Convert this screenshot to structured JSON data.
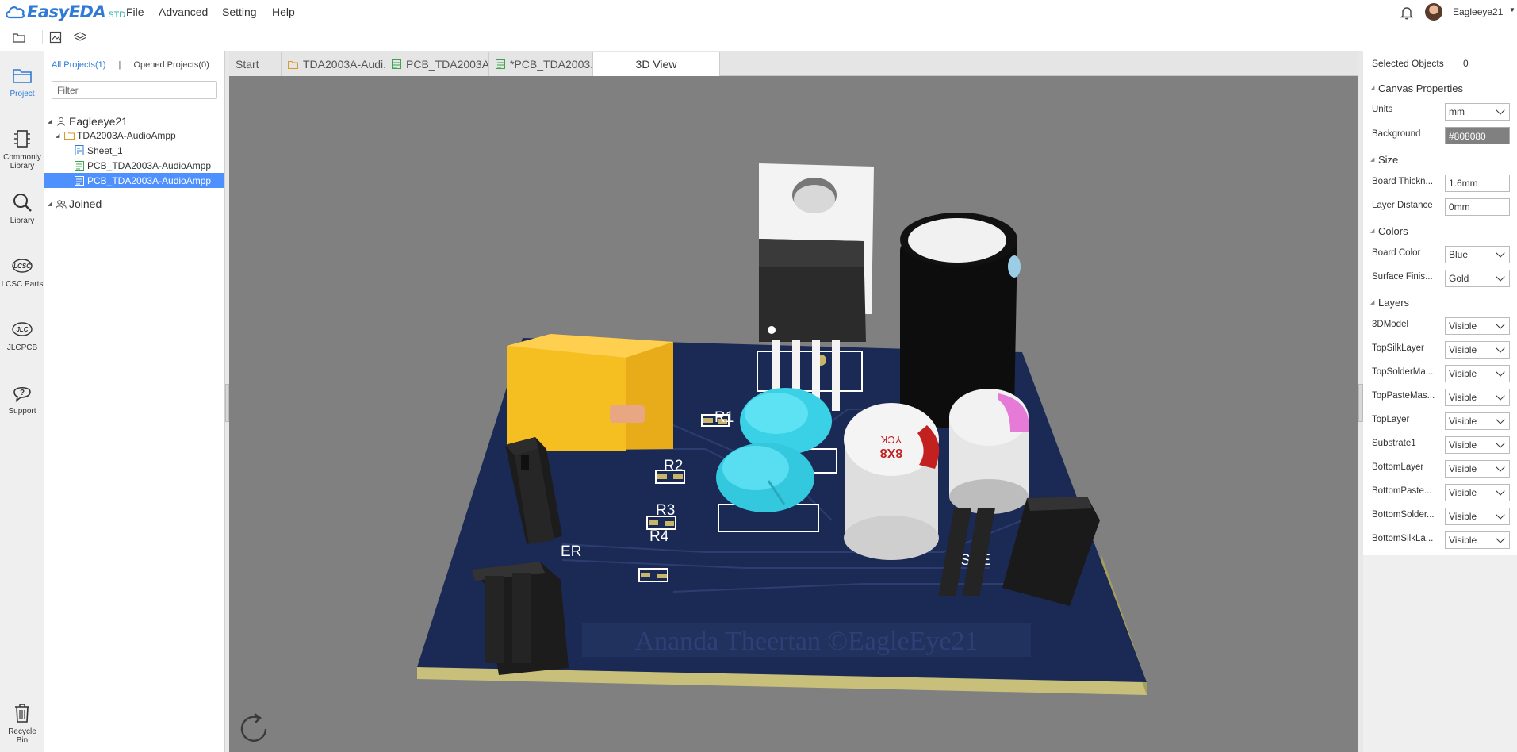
{
  "app": {
    "brand": "EasyEDA",
    "edition": "STD",
    "menu": [
      "File",
      "Advanced",
      "Setting",
      "Help"
    ],
    "username": "Eagleeye21"
  },
  "rail": {
    "items": [
      {
        "label1": "Project",
        "label2": "",
        "icon": "project-icon"
      },
      {
        "label1": "Commonly",
        "label2": "Library",
        "icon": "commonly-library-icon"
      },
      {
        "label1": "Library",
        "label2": "",
        "icon": "library-search-icon"
      },
      {
        "label1": "LCSC Parts",
        "label2": "",
        "icon": "lcsc-icon"
      },
      {
        "label1": "JLCPCB",
        "label2": "",
        "icon": "jlcpcb-icon"
      },
      {
        "label1": "Support",
        "label2": "",
        "icon": "support-icon"
      },
      {
        "label1": "Recycle",
        "label2": "Bin",
        "icon": "trash-icon"
      }
    ]
  },
  "project_panel": {
    "tab_all": "All Projects(1)",
    "tab_separator": "|",
    "tab_opened": "Opened Projects(0)",
    "filter_placeholder": "Filter",
    "tree": {
      "owner": "Eagleeye21",
      "project": "TDA2003A-AudioAmpp",
      "sheet": "Sheet_1",
      "pcb1": "PCB_TDA2003A-AudioAmpp",
      "pcb2": "PCB_TDA2003A-AudioAmpp",
      "joined": "Joined"
    }
  },
  "doc_tabs": {
    "start": "Start",
    "schematic": "TDA2003A-Audi...",
    "pcb": "PCB_TDA2003A...",
    "pcb_modified": "*PCB_TDA2003...",
    "view3d": "3D View"
  },
  "scene": {
    "silk_r1": "R1",
    "silk_r2": "R2",
    "silk_r3": "R3",
    "silk_r4": "R4",
    "silk_er": "ER",
    "silk_spe": "SPE",
    "watermark": "Ananda Theertan ©EagleEye21",
    "cap_marking_1": "8X8",
    "cap_marking_2": "YCK"
  },
  "properties": {
    "selected_label": "Selected Objects",
    "selected_count": "0",
    "canvas_header": "Canvas Properties",
    "units_label": "Units",
    "units_value": "mm",
    "background_label": "Background",
    "background_value": "#808080",
    "size_header": "Size",
    "thickness_label": "Board Thickn...",
    "thickness_value": "1.6mm",
    "layer_distance_label": "Layer Distance",
    "layer_distance_value": "0mm",
    "colors_header": "Colors",
    "board_color_label": "Board Color",
    "board_color_value": "Blue",
    "surface_label": "Surface Finis...",
    "surface_value": "Gold",
    "layers_header": "Layers",
    "layers": [
      {
        "label": "3DModel",
        "value": "Visible"
      },
      {
        "label": "TopSilkLayer",
        "value": "Visible"
      },
      {
        "label": "TopSolderMa...",
        "value": "Visible"
      },
      {
        "label": "TopPasteMas...",
        "value": "Visible"
      },
      {
        "label": "TopLayer",
        "value": "Visible"
      },
      {
        "label": "Substrate1",
        "value": "Visible"
      },
      {
        "label": "BottomLayer",
        "value": "Visible"
      },
      {
        "label": "BottomPaste...",
        "value": "Visible"
      },
      {
        "label": "BottomSolder...",
        "value": "Visible"
      },
      {
        "label": "BottomSilkLa...",
        "value": "Visible"
      }
    ]
  },
  "colors": {
    "accent": "#2f7ad6",
    "board": "#1b2a55",
    "viewport_bg": "#808080",
    "selection": "#4d90fe"
  }
}
